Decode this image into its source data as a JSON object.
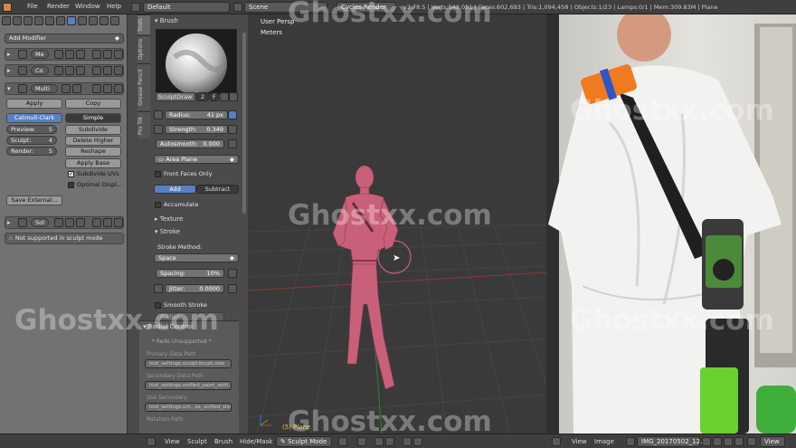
{
  "topbar": {
    "menus": [
      "File",
      "Render",
      "Window",
      "Help"
    ],
    "layout": "Default",
    "scene": "Scene",
    "engine": "Cycles Render",
    "stats": "v2.78.5 | Verts:549,051 | Faces:602,693 | Tris:1,094,458 | Objects:1/23 | Lamps:0/1 | Mem:309.83M | Plane"
  },
  "modifiers": {
    "add_modifier": "Add Modifier",
    "mod1_name": "Me",
    "mod2_name": "Co",
    "mod3_name": "Multi",
    "apply": "Apply",
    "copy": "Copy",
    "catmull_clark": "Catmull-Clark",
    "simple": "Simple",
    "preview_label": "Preview:",
    "preview_value": "5",
    "sculpt_label": "Sculpt:",
    "sculpt_value": "4",
    "render_label": "Render:",
    "render_value": "5",
    "subdivide": "Subdivide",
    "delete_higher": "Delete Higher",
    "reshape": "Reshape",
    "apply_base": "Apply Base",
    "subdivide_uvs": "Subdivide UVs",
    "optimal_display": "Optimal Displ...",
    "save_external": "Save External...",
    "mod4_name": "Sol",
    "warning": "Not supported in sculpt mode"
  },
  "tabs": [
    "Tools",
    "Options",
    "Grease Pencil",
    "Pro Tik"
  ],
  "brush": {
    "header": "Brush",
    "name": "SculptDraw",
    "users": "2",
    "fake_user": "F",
    "radius": "Radius:",
    "radius_value": "41 px",
    "strength": "Strength:",
    "strength_value": "0.349",
    "autosmooth": "Autosmooth:",
    "autosmooth_value": "0.000",
    "area_plane": "Area Plane",
    "front_faces": "Front Faces Only",
    "add": "Add",
    "subtract": "Subtract",
    "accumulate": "Accumulate",
    "texture": "Texture",
    "stroke": "Stroke",
    "stroke_method": "Stroke Method:",
    "space": "Space",
    "spacing": "Spacing:",
    "spacing_value": "10%",
    "jitter": "Jitter:",
    "jitter_value": "0.0000",
    "smooth_stroke": "Smooth Stroke",
    "radius_short": "Radius:",
    "radial_control": "Radial Control",
    "redo_unsupported": "* Redo Unsupported *",
    "primary_data_path": "Primary Data Path",
    "primary_value": "tool_settings.sculpt.brush.size",
    "secondary_data_path": "Secondary Data Path",
    "secondary_value": "tool_settings.unified_paint_setti...",
    "use_secondary": "Use Secondary",
    "use_secondary_value": "tool_settings.uni...se_unified_size",
    "rotation_path": "Rotation Path"
  },
  "viewport": {
    "view_name": "User Persp",
    "units": "Meters",
    "object_label": "(5) Plane"
  },
  "watermark": "Ghostxx.com",
  "bottombar": {
    "view": "View",
    "sculpt": "Sculpt",
    "brush": "Brush",
    "hide_mask": "Hide/Mask",
    "mode": "Sculpt Mode",
    "right_view": "View",
    "image": "Image",
    "image_name": "IMG_20170502_12...",
    "right_view2": "View"
  },
  "colors": {
    "accent_blue": "#5680c2",
    "model_pink": "#c9607a",
    "panel_gray": "#727272"
  }
}
